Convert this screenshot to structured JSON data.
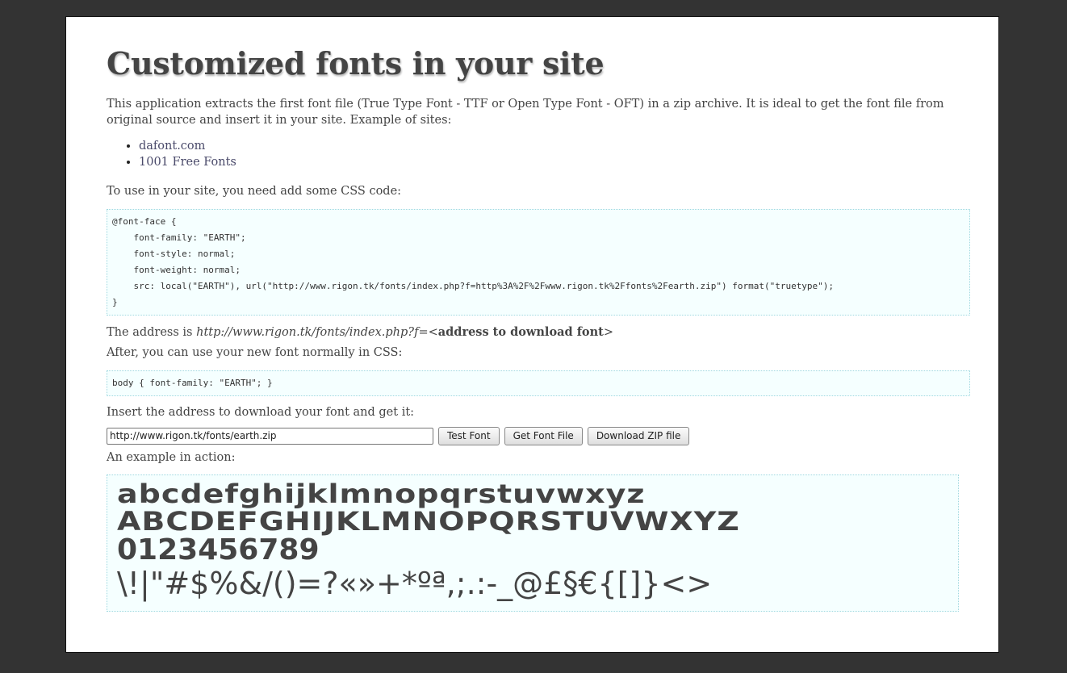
{
  "heading": "Customized fonts in your site",
  "intro": "This application extracts the first font file (True Type Font - TTF or Open Type Font - OFT) in a zip archive. It is ideal to get the font file from original source and insert it in your site. Example of sites:",
  "sites": [
    {
      "label": "dafont.com"
    },
    {
      "label": "1001 Free Fonts"
    }
  ],
  "use_css_text": "To use in your site, you need add some CSS code:",
  "code_block_1": "@font-face {\n    font-family: \"EARTH\";\n    font-style: normal;\n    font-weight: normal;\n    src: local(\"EARTH\"), url(\"http://www.rigon.tk/fonts/index.php?f=http%3A%2F%2Fwww.rigon.tk%2Ffonts%2Fearth.zip\") format(\"truetype\");\n}",
  "address": {
    "prefix": "The address is ",
    "url": "http://www.rigon.tk/fonts/index.php?f",
    "equals": "=<",
    "bold": "address to download font",
    "suffix": ">"
  },
  "after_text": "After, you can use your new font normally in CSS:",
  "code_block_2": "body { font-family: \"EARTH\"; }",
  "insert_text": "Insert the address to download your font and get it:",
  "form": {
    "url_value": "http://www.rigon.tk/fonts/earth.zip",
    "test_label": "Test Font",
    "get_label": "Get Font File",
    "download_label": "Download ZIP file"
  },
  "example_label": "An example in action:",
  "sample": {
    "line1": "abcdefghijklmnopqrstuvwxyz",
    "line2": "ABCDEFGHIJKLMNOPQRSTUVWXYZ",
    "line3": "0123456789",
    "line4": "\\!|\"#$%&/()=?«»+*ºª,;.:-_@£§€{[]}<>"
  },
  "colors": {
    "background": "#333333",
    "page": "#ffffff",
    "text": "#444444",
    "code_bg": "#f5ffff",
    "code_border": "#a0d8e0",
    "link": "#4a4a6a"
  }
}
